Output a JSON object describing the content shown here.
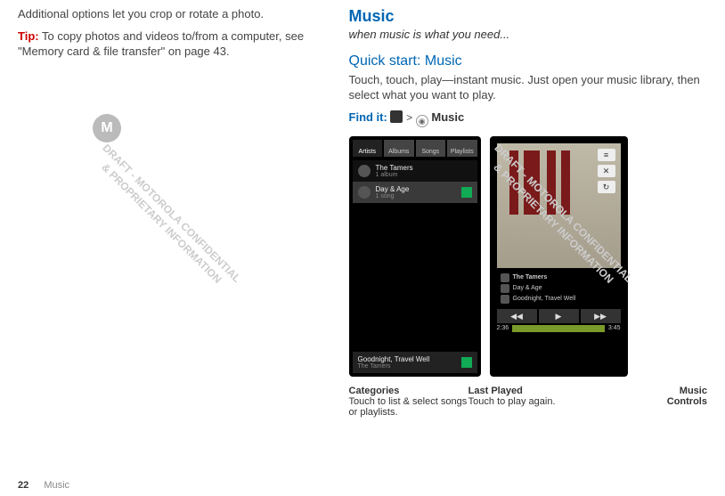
{
  "left": {
    "para1": "Additional options let you crop or rotate a photo.",
    "tip_label": "Tip:",
    "tip_text": " To copy photos and videos to/from a computer, see \"Memory card & file transfer\" on page 43."
  },
  "right": {
    "section_title": "Music",
    "tagline": "when music is what you need...",
    "quickstart": "Quick start: Music",
    "qs_para": "Touch, touch, play—instant music. Just open your music library, then select what you want to play.",
    "findit_label": "Find it:",
    "findit_gt": ">",
    "findit_music": "Music"
  },
  "phone_a": {
    "tabs": [
      "Artists",
      "Albums",
      "Songs",
      "Playlists"
    ],
    "active_tab": 0,
    "row1_main": "The Tamers",
    "row1_sub": "1 album",
    "row2_main": "Day & Age",
    "row2_sub": "1 song",
    "bottom_main": "Goodnight, Travel Well",
    "bottom_sub": "The Tamers"
  },
  "phone_b": {
    "side_btns": [
      "≡",
      "✕",
      "↻"
    ],
    "artist": "The Tamers",
    "album": "Day & Age",
    "track": "Goodnight, Travel Well",
    "play_ctrl": [
      "◀◀",
      "▶",
      "▶▶"
    ],
    "time_cur": "2:36",
    "time_total": "3:45"
  },
  "legend": {
    "cat_h": "Categories",
    "cat_t": "Touch to list & select songs or playlists.",
    "last_h": "Last Played",
    "last_t": "Touch to play again.",
    "music_h1": "Music",
    "music_h2": "Controls"
  },
  "footer": {
    "page": "22",
    "section": "Music"
  },
  "watermark": "DRAFT - MOTOROLA CONFIDENTIAL\n& PROPRIETARY INFORMATION",
  "moto_badge": "M"
}
